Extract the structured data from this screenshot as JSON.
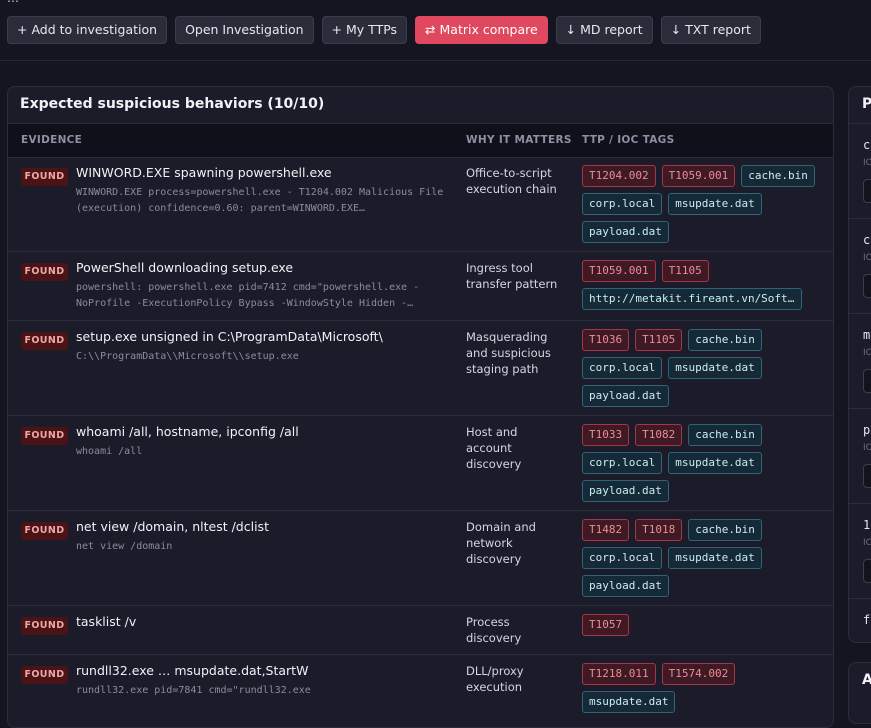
{
  "toolbar": {
    "buttons": [
      {
        "label": "+ Add to investigation",
        "primary": false
      },
      {
        "label": "Open Investigation",
        "primary": false
      },
      {
        "label": "+ My TTPs",
        "primary": false
      },
      {
        "label": "⇄ Matrix compare",
        "primary": true
      },
      {
        "label": "↓ MD report",
        "primary": false
      },
      {
        "label": "↓ TXT report",
        "primary": false
      }
    ]
  },
  "panel": {
    "title": "Expected suspicious behaviors (10/10)",
    "columns": {
      "evidence": "EVIDENCE",
      "why": "WHY IT MATTERS",
      "tags": "TTP / IOC TAGS"
    },
    "rows": [
      {
        "status": "FOUND",
        "title": "WINWORD.EXE spawning powershell.exe",
        "detail": "WINWORD.EXE process=powershell.exe - T1204.002 Malicious File (execution) confidence=0.60: parent=WINWORD.EXE…",
        "why": "Office-to-script execution chain",
        "tags": [
          {
            "text": "T1204.002",
            "kind": "ttp"
          },
          {
            "text": "T1059.001",
            "kind": "ttp"
          },
          {
            "text": "cache.bin",
            "kind": "ioc"
          },
          {
            "text": "corp.local",
            "kind": "ioc"
          },
          {
            "text": "msupdate.dat",
            "kind": "ioc"
          },
          {
            "text": "payload.dat",
            "kind": "ioc"
          }
        ]
      },
      {
        "status": "FOUND",
        "title": "PowerShell downloading setup.exe",
        "detail": "powershell: powershell.exe pid=7412 cmd=\"powershell.exe -NoProfile -ExecutionPolicy Bypass -WindowStyle Hidden -…",
        "why": "Ingress tool transfer pattern",
        "tags": [
          {
            "text": "T1059.001",
            "kind": "ttp"
          },
          {
            "text": "T1105",
            "kind": "ttp"
          },
          {
            "text": "http://metakit.fireant.vn/Softwar…",
            "kind": "ioc"
          }
        ]
      },
      {
        "status": "FOUND",
        "title": "setup.exe unsigned in C:\\ProgramData\\Microsoft\\",
        "detail": "C:\\\\ProgramData\\\\Microsoft\\\\setup.exe",
        "why": "Masquerading and suspicious staging path",
        "tags": [
          {
            "text": "T1036",
            "kind": "ttp"
          },
          {
            "text": "T1105",
            "kind": "ttp"
          },
          {
            "text": "cache.bin",
            "kind": "ioc"
          },
          {
            "text": "corp.local",
            "kind": "ioc"
          },
          {
            "text": "msupdate.dat",
            "kind": "ioc"
          },
          {
            "text": "payload.dat",
            "kind": "ioc"
          }
        ]
      },
      {
        "status": "FOUND",
        "title": "whoami /all, hostname, ipconfig /all",
        "detail": "whoami /all",
        "why": "Host and account discovery",
        "tags": [
          {
            "text": "T1033",
            "kind": "ttp"
          },
          {
            "text": "T1082",
            "kind": "ttp"
          },
          {
            "text": "cache.bin",
            "kind": "ioc"
          },
          {
            "text": "corp.local",
            "kind": "ioc"
          },
          {
            "text": "msupdate.dat",
            "kind": "ioc"
          },
          {
            "text": "payload.dat",
            "kind": "ioc"
          }
        ]
      },
      {
        "status": "FOUND",
        "title": "net view /domain, nltest /dclist",
        "detail": "net view /domain",
        "why": "Domain and network discovery",
        "tags": [
          {
            "text": "T1482",
            "kind": "ttp"
          },
          {
            "text": "T1018",
            "kind": "ttp"
          },
          {
            "text": "cache.bin",
            "kind": "ioc"
          },
          {
            "text": "corp.local",
            "kind": "ioc"
          },
          {
            "text": "msupdate.dat",
            "kind": "ioc"
          },
          {
            "text": "payload.dat",
            "kind": "ioc"
          }
        ]
      },
      {
        "status": "FOUND",
        "title": "tasklist /v",
        "detail": "",
        "why": "Process discovery",
        "tags": [
          {
            "text": "T1057",
            "kind": "ttp"
          }
        ]
      },
      {
        "status": "FOUND",
        "title": "rundll32.exe … msupdate.dat,StartW",
        "detail": "rundll32.exe pid=7841 cmd=\"rundll32.exe",
        "why": "DLL/proxy execution",
        "tags": [
          {
            "text": "T1218.011",
            "kind": "ttp"
          },
          {
            "text": "T1574.002",
            "kind": "ttp"
          },
          {
            "text": "msupdate.dat",
            "kind": "ioc"
          }
        ]
      }
    ]
  },
  "side_panel": {
    "title": "P",
    "items": [
      {
        "name": "ca",
        "sub": "IO"
      },
      {
        "name": "co",
        "sub": "IO"
      },
      {
        "name": "ms",
        "sub": "IO"
      },
      {
        "name": "pa",
        "sub": "IO"
      },
      {
        "name": "10",
        "sub": "IO"
      },
      {
        "name": "fe",
        "sub": ""
      }
    ]
  },
  "side_panel_2": {
    "title": "A"
  },
  "colors": {
    "background": "#151522",
    "panel": "#1b1b29",
    "accent": "#e0485f",
    "found_badge": "#4a1416",
    "ttp_tag": "#f08a98",
    "ioc_tag": "#c9edf5"
  }
}
